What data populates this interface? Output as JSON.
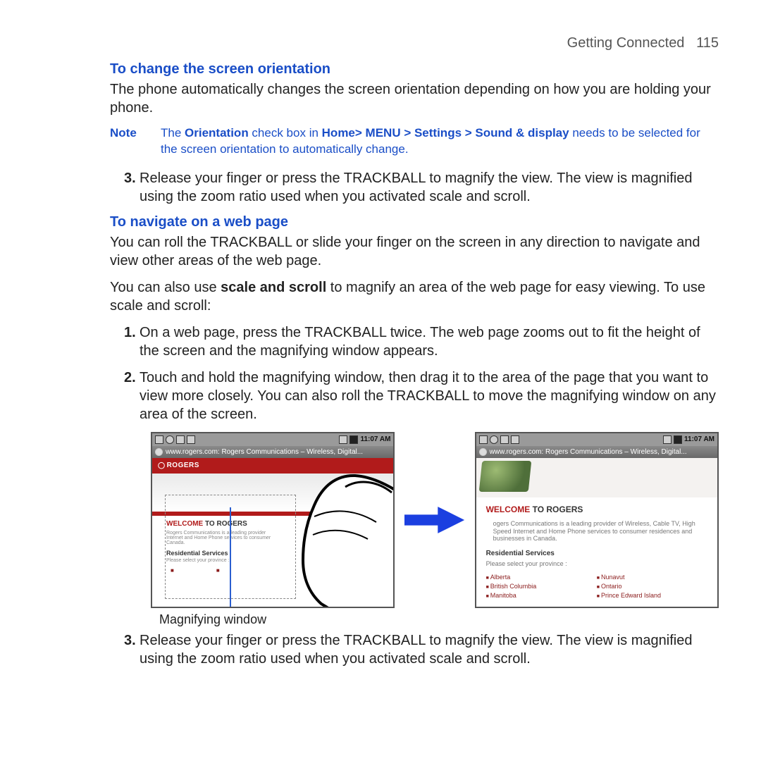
{
  "header": {
    "section": "Getting Connected",
    "page": "115"
  },
  "h1": "To change the screen orientation",
  "p1": "The phone automatically changes the screen orientation depending on how you are holding your phone.",
  "note": {
    "label": "Note",
    "prefix": "The ",
    "b1": "Orientation",
    "mid1": " check box in ",
    "b2": "Home> MENU > Settings > Sound & display",
    "mid2": " needs to be selected for the screen orientation to automatically change."
  },
  "step3a": "Release your finger or press the TRACKBALL to magnify the view. The view is magnified using the zoom ratio used when you activated scale and scroll.",
  "h2": "To navigate on a web page",
  "p2": "You can roll the TRACKBALL or slide your finger on the screen in any direction to navigate and view other areas of the web page.",
  "p3_pre": "You can also use ",
  "p3_b": "scale and scroll",
  "p3_post": " to magnify an area of the web page for easy viewing. To use scale and scroll:",
  "step1": "On a web page, press the TRACKBALL twice. The web page zooms out to fit the height of the screen and the magnifying window appears.",
  "step2": "Touch and hold the magnifying window, then drag it to the area of the page that you want to view more closely. You can also roll the TRACKBALL to move the magnifying window on any area of the screen.",
  "screens": {
    "time": "11:07 AM",
    "url": "www.rogers.com: Rogers Communications – Wireless, Digital...",
    "logo": "ROGERS",
    "welcome_red": "WELCOME",
    "welcome_rest": " TO ROGERS",
    "mini_desc1": "Rogers Communications is a leading provider",
    "mini_desc2": "Internet and Home Phone services to consumer",
    "mini_desc3": "Canada.",
    "res_services": "Residential Services",
    "select_prov": "Please select your province :",
    "right_desc": "ogers Communications is a leading provider of Wireless, Cable TV, High Speed Internet and Home Phone services to consumer residences and businesses in Canada.",
    "provinces_left": [
      "Alberta",
      "British Columbia",
      "Manitoba"
    ],
    "provinces_right": [
      "Nunavut",
      "Ontario",
      "Prince Edward Island"
    ]
  },
  "caption": "Magnifying window",
  "nums": {
    "n1": "1.",
    "n2": "2.",
    "n3": "3."
  },
  "step3b": "Release your finger or press the TRACKBALL to magnify the view. The view is magnified using the zoom ratio used when you activated scale and scroll."
}
